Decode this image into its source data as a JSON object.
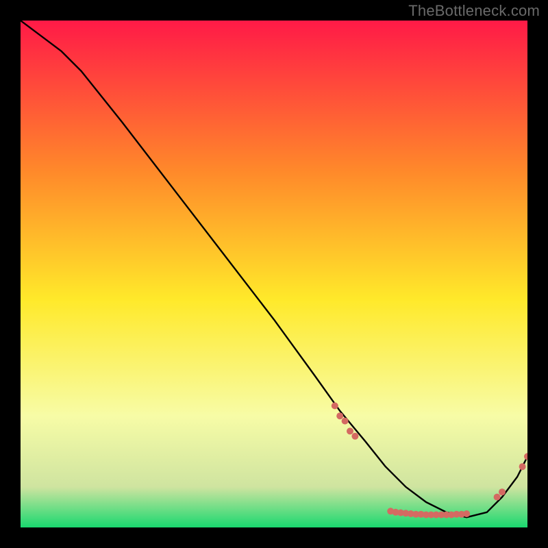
{
  "watermark": "TheBottleneck.com",
  "chart_data": {
    "type": "line",
    "title": "",
    "xlabel": "",
    "ylabel": "",
    "xlim": [
      0,
      100
    ],
    "ylim": [
      0,
      100
    ],
    "grid": false,
    "legend": false,
    "background_gradient": {
      "top": "#ff1a47",
      "mid_upper": "#ff8a2a",
      "mid": "#ffe92a",
      "mid_lower": "#f7fca6",
      "band": "#cfe4a0",
      "bottom": "#19d86f"
    },
    "series": [
      {
        "name": "curve",
        "stroke": "#000000",
        "x": [
          0,
          4,
          8,
          12,
          20,
          30,
          40,
          50,
          58,
          63,
          68,
          72,
          76,
          80,
          84,
          88,
          92,
          95,
          98,
          100
        ],
        "y": [
          100,
          97,
          94,
          90,
          80,
          67,
          54,
          41,
          30,
          23,
          17,
          12,
          8,
          5,
          3,
          2,
          3,
          6,
          10,
          14
        ]
      }
    ],
    "markers": {
      "color": "#d46a62",
      "radius": 5,
      "points": [
        {
          "x": 62,
          "y": 24
        },
        {
          "x": 63,
          "y": 22
        },
        {
          "x": 64,
          "y": 21
        },
        {
          "x": 65,
          "y": 19
        },
        {
          "x": 66,
          "y": 18
        },
        {
          "x": 73,
          "y": 3.2
        },
        {
          "x": 74,
          "y": 3.0
        },
        {
          "x": 75,
          "y": 2.9
        },
        {
          "x": 76,
          "y": 2.8
        },
        {
          "x": 77,
          "y": 2.7
        },
        {
          "x": 78,
          "y": 2.6
        },
        {
          "x": 79,
          "y": 2.6
        },
        {
          "x": 80,
          "y": 2.5
        },
        {
          "x": 81,
          "y": 2.5
        },
        {
          "x": 82,
          "y": 2.5
        },
        {
          "x": 83,
          "y": 2.5
        },
        {
          "x": 84,
          "y": 2.5
        },
        {
          "x": 85,
          "y": 2.5
        },
        {
          "x": 86,
          "y": 2.6
        },
        {
          "x": 87,
          "y": 2.6
        },
        {
          "x": 88,
          "y": 2.7
        },
        {
          "x": 94,
          "y": 6
        },
        {
          "x": 95,
          "y": 7
        },
        {
          "x": 99,
          "y": 12
        },
        {
          "x": 100,
          "y": 14
        }
      ]
    }
  }
}
